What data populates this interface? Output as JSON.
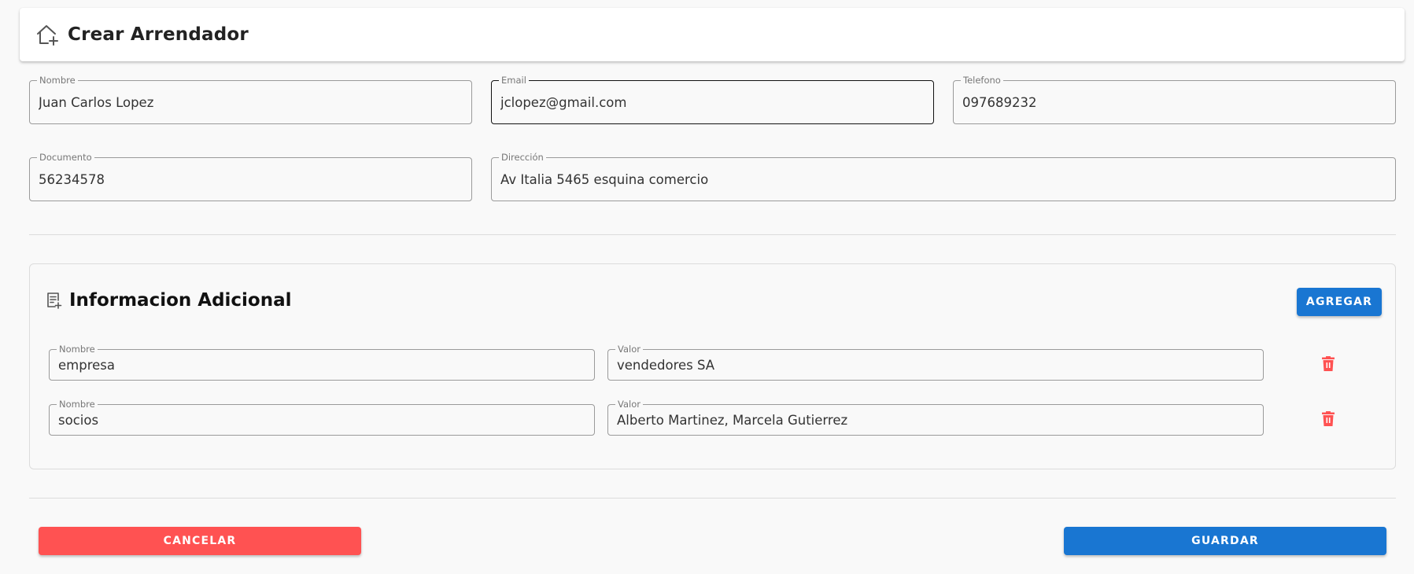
{
  "header": {
    "title": "Crear Arrendador",
    "icon": "home-plus-icon"
  },
  "form": {
    "nombre": {
      "label": "Nombre",
      "value": "Juan Carlos Lopez"
    },
    "email": {
      "label": "Email",
      "value": "jclopez@gmail.com"
    },
    "telefono": {
      "label": "Telefono",
      "value": "097689232"
    },
    "documento": {
      "label": "Documento",
      "value": "56234578"
    },
    "direccion": {
      "label": "Dirección",
      "value": "Av Italia 5465 esquina comercio"
    }
  },
  "additional_info": {
    "title": "Informacion Adicional",
    "icon": "note-plus-icon",
    "add_button": "AGREGAR",
    "rows": [
      {
        "name_label": "Nombre",
        "name_value": "empresa",
        "value_label": "Valor",
        "value_value": "vendedores SA"
      },
      {
        "name_label": "Nombre",
        "name_value": "socios",
        "value_label": "Valor",
        "value_value": "Alberto Martinez, Marcela Gutierrez"
      }
    ]
  },
  "actions": {
    "cancel": "CANCELAR",
    "save": "GUARDAR"
  },
  "colors": {
    "primary": "#1976d2",
    "danger": "#ff5252",
    "background": "#f9f9f9"
  }
}
